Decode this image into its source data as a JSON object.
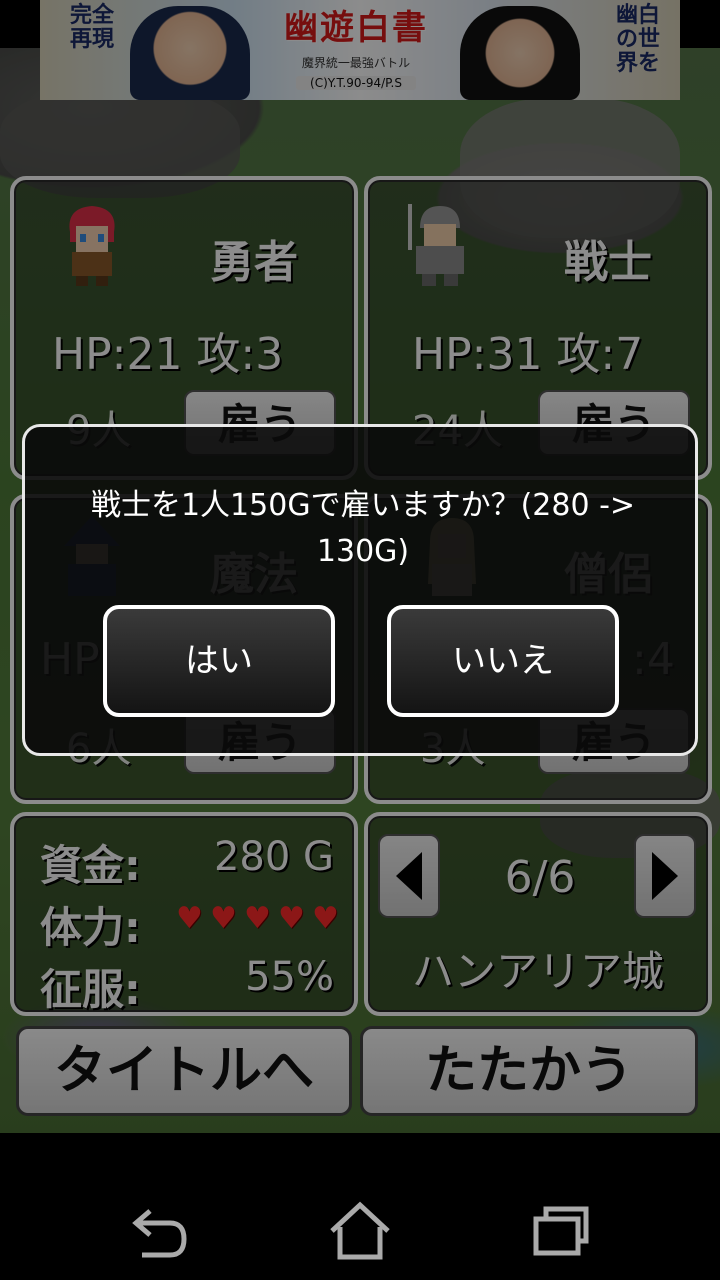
{
  "ad": {
    "left_text": "完全再現",
    "logo_text": "幽遊白書",
    "subtitle": "魔界統一最強バトル",
    "copyright": "(C)Y.T.90-94/P.S",
    "right_text": "幽白の世界を"
  },
  "units": [
    {
      "name": "勇者",
      "stats": "HP:21 攻:3",
      "count": "9人",
      "hire_label": "雇う"
    },
    {
      "name": "戦士",
      "stats": "HP:31 攻:7",
      "count": "24人",
      "hire_label": "雇う"
    },
    {
      "name": "魔法",
      "stats": "HP",
      "count": "6人",
      "hire_label": "雇う"
    },
    {
      "name": "僧侶",
      "stats": ":4",
      "count": "3人",
      "hire_label": "雇う"
    }
  ],
  "status": {
    "money_label": "資金:",
    "money_value": "280 G",
    "stamina_label": "体力:",
    "hearts": 5,
    "conquest_label": "征服:",
    "conquest_value": "55%"
  },
  "castle": {
    "page": "6/6",
    "name": "ハンアリア城"
  },
  "buttons": {
    "title": "タイトルへ",
    "fight": "たたかう"
  },
  "dialog": {
    "message": "戦士を1人150Gで雇いますか？(280 -> 130G)",
    "yes": "はい",
    "no": "いいえ"
  },
  "icons": [
    "back-icon",
    "home-icon",
    "recent-apps-icon",
    "heart-icon",
    "arrow-left-icon",
    "arrow-right-icon"
  ],
  "colors": {
    "heart": "#ff2a2a",
    "dialog_bg": "#0a0a0a"
  }
}
